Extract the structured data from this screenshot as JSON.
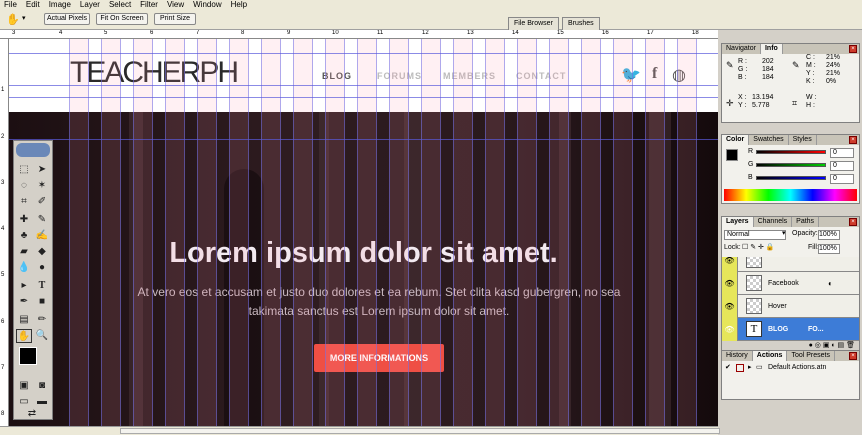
{
  "menu": [
    "File",
    "Edit",
    "Image",
    "Layer",
    "Select",
    "Filter",
    "View",
    "Window",
    "Help"
  ],
  "options_bar": {
    "actual_pixels": "Actual Pixels",
    "fit_on_screen": "Fit On Screen",
    "print_size": "Print Size",
    "tab_file_browser": "File Browser",
    "tab_brushes": "Brushes"
  },
  "ruler_top": [
    "3",
    "4",
    "5",
    "6",
    "7",
    "8",
    "9",
    "10",
    "11",
    "12",
    "13",
    "14",
    "15",
    "16",
    "17",
    "18"
  ],
  "ruler_left": [
    "1",
    "2",
    "3",
    "4",
    "5",
    "6",
    "7",
    "8"
  ],
  "design": {
    "logo": "TEACHERPH",
    "nav": [
      "BLOG",
      "FORUMS",
      "MEMBERS",
      "CONTACT"
    ],
    "hero_title": "Lorem ipsum dolor sit amet.",
    "hero_sub_line1": "At vero eos et accusam et justo duo dolores et ea rebum. Stet clita kasd gubergren, no sea",
    "hero_sub_line2": "takimata sanctus est Lorem ipsum dolor sit amet.",
    "hero_button": "MORE INFORMATIONS",
    "accent": "#ef4f44"
  },
  "navigator_panel": {
    "tabs": [
      "Navigator",
      "Info"
    ],
    "r_label": "R :",
    "r": "202",
    "g_label": "G :",
    "g": "184",
    "b_label": "B :",
    "b": "184",
    "c_label": "C :",
    "c": "21%",
    "m_label": "M :",
    "m": "24%",
    "y_label": "Y :",
    "y": "21%",
    "k_label": "K :",
    "k": "0%",
    "x_label": "X :",
    "x": "13.194",
    "yy_label": "Y :",
    "yy": "5.778",
    "w_label": "W :",
    "h_label": "H :"
  },
  "color_panel": {
    "tabs": [
      "Color",
      "Swatches",
      "Styles"
    ],
    "r_label": "R",
    "r": "0",
    "g_label": "G",
    "g": "0",
    "b_label": "B",
    "b": "0"
  },
  "layers_panel": {
    "tabs": [
      "Layers",
      "Channels",
      "Paths"
    ],
    "blend_mode": "Normal",
    "opacity_label": "Opacity:",
    "opacity": "100%",
    "lock_label": "Lock:",
    "fill_label": "Fill:",
    "fill": "100%",
    "layers": [
      "Facebook",
      "Hover",
      "BLOG"
    ],
    "selected_layer_extra": "FO..."
  },
  "history_panel": {
    "tabs": [
      "History",
      "Actions",
      "Tool Presets"
    ],
    "action_set": "Default Actions.atn"
  }
}
